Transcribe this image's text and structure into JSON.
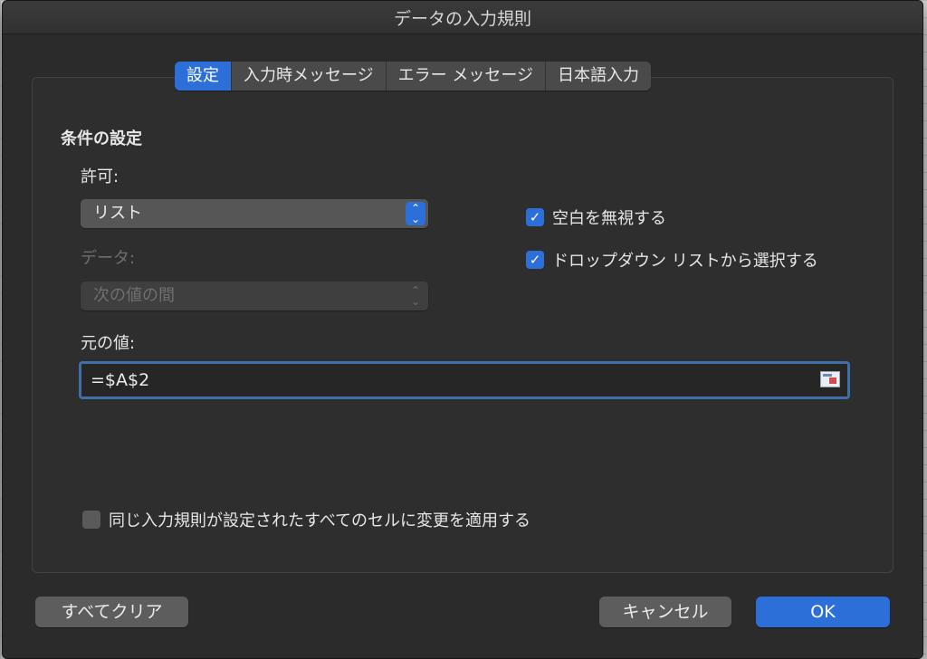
{
  "dialog": {
    "title": "データの入力規則"
  },
  "tabs": [
    {
      "label": "設定",
      "active": true
    },
    {
      "label": "入力時メッセージ",
      "active": false
    },
    {
      "label": "エラー メッセージ",
      "active": false
    },
    {
      "label": "日本語入力",
      "active": false
    }
  ],
  "settings": {
    "section_title": "条件の設定",
    "allow_label": "許可:",
    "allow_value": "リスト",
    "data_label": "データ:",
    "data_value": "次の値の間",
    "source_label": "元の値:",
    "source_value": "=$A$2",
    "ignore_blank": {
      "label": "空白を無視する",
      "checked": true
    },
    "in_cell_dropdown": {
      "label": "ドロップダウン リストから選択する",
      "checked": true
    },
    "apply_all": {
      "label": "同じ入力規則が設定されたすべてのセルに変更を適用する",
      "checked": false
    }
  },
  "buttons": {
    "clear_all": "すべてクリア",
    "cancel": "キャンセル",
    "ok": "OK"
  },
  "icons": {
    "check": "checkmark-icon",
    "chevron": "up-down-chevron-icon",
    "picker": "range-picker-icon"
  },
  "colors": {
    "accent": "#2d6fd8",
    "dialog_bg": "#2b2b2b",
    "field_border": "#3e6fa8"
  }
}
